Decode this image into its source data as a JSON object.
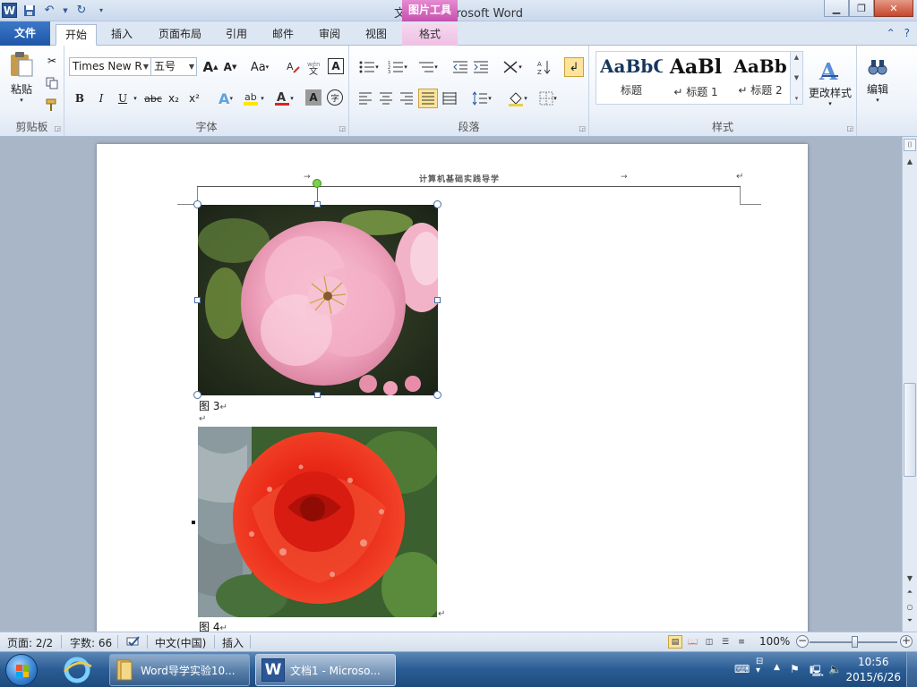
{
  "window": {
    "title": "文档1 - Microsoft Word",
    "context_tab_group": "图片工具"
  },
  "tabs": {
    "file": "文件",
    "items": [
      "开始",
      "插入",
      "页面布局",
      "引用",
      "邮件",
      "审阅",
      "视图"
    ],
    "active": "开始",
    "context": "格式"
  },
  "ribbon": {
    "clipboard": {
      "paste_label": "粘贴",
      "group_label": "剪贴板"
    },
    "font": {
      "font_name": "Times New R",
      "font_size": "五号",
      "grow_label": "A",
      "shrink_label": "A",
      "case_label": "Aa",
      "bold": "B",
      "italic": "I",
      "underline": "U",
      "strike": "abc",
      "subscript": "x₂",
      "superscript": "x²",
      "group_label": "字体"
    },
    "paragraph": {
      "group_label": "段落"
    },
    "styles": {
      "items": [
        {
          "sample": "AaBbC",
          "name": "标题"
        },
        {
          "sample": "AaBl",
          "name": "标题 1"
        },
        {
          "sample": "AaBb",
          "name": "标题 2"
        }
      ],
      "change_styles_label": "更改样式",
      "group_label": "样式"
    },
    "editing": {
      "label": "编辑"
    }
  },
  "document": {
    "header_text": "计算机基础实践导学",
    "figures": [
      {
        "caption": "图 3"
      },
      {
        "caption": "图 4"
      }
    ]
  },
  "statusbar": {
    "page": "页面: 2/2",
    "words": "字数: 66",
    "language": "中文(中国)",
    "mode": "插入",
    "zoom": "100%",
    "zoom_level": 1.0
  },
  "taskbar": {
    "buttons": [
      {
        "label": "Word导学实验10...",
        "icon": "folder-icon",
        "active": false
      },
      {
        "label": "文档1 - Microso...",
        "icon": "word-icon",
        "active": true
      }
    ],
    "clock_time": "10:56",
    "clock_date": "2015/6/26"
  },
  "colors": {
    "accent": "#2b5797",
    "context_tab": "#c64fae",
    "file_tab": "#2a64b5"
  }
}
